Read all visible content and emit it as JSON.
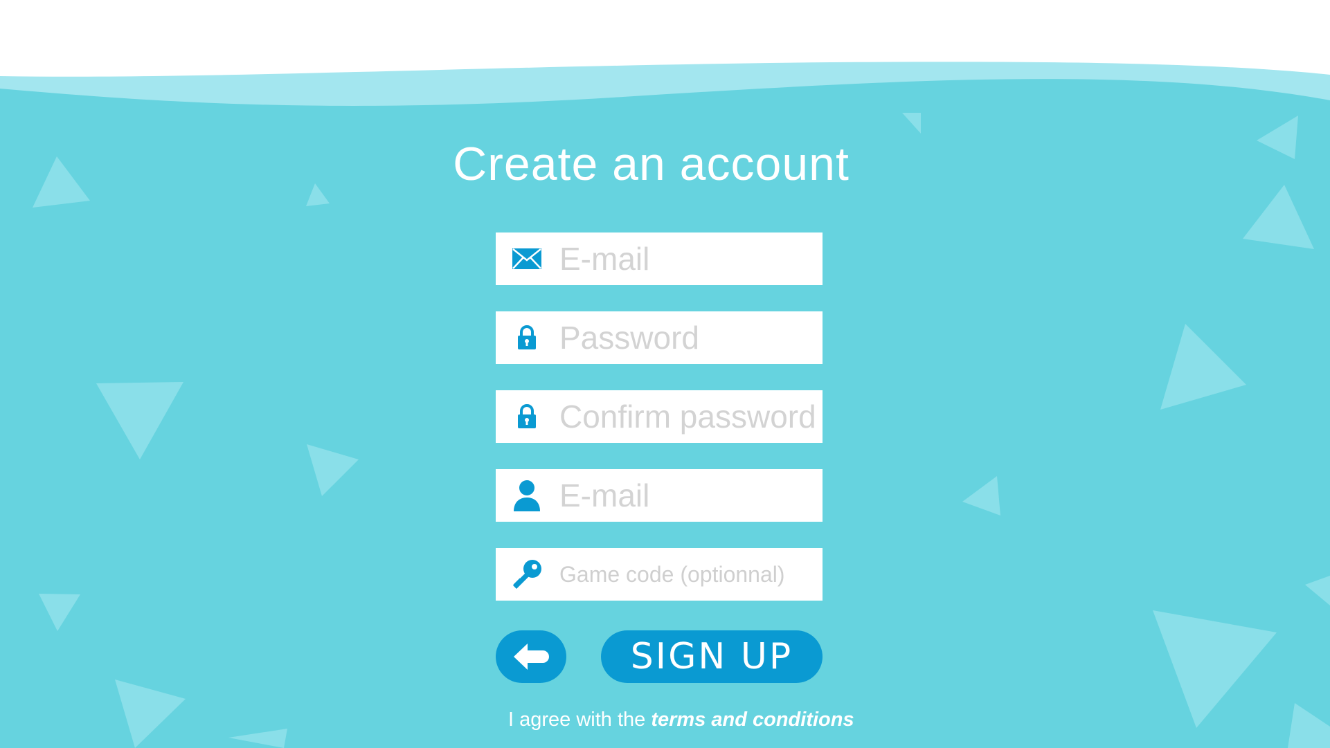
{
  "page": {
    "title": "Create an account"
  },
  "form": {
    "fields": [
      {
        "name": "email",
        "placeholder": "E-mail",
        "icon": "envelope-icon"
      },
      {
        "name": "password",
        "placeholder": "Password",
        "icon": "lock-icon"
      },
      {
        "name": "confirm_password",
        "placeholder": "Confirm password",
        "icon": "lock-icon"
      },
      {
        "name": "username",
        "placeholder": "E-mail",
        "icon": "user-icon"
      },
      {
        "name": "game_code",
        "placeholder": "Game code (optionnal)",
        "icon": "key-icon"
      }
    ]
  },
  "actions": {
    "back_icon": "arrow-left-icon",
    "signup_label": "SIGN UP"
  },
  "terms": {
    "prefix": "I agree with the ",
    "link_label": "terms and conditions"
  },
  "colors": {
    "background": "#66d3df",
    "wave_light": "#a3e6ef",
    "accent": "#0a9ad2",
    "triangles": "#8adfe9",
    "placeholder": "#d3d3d3"
  }
}
